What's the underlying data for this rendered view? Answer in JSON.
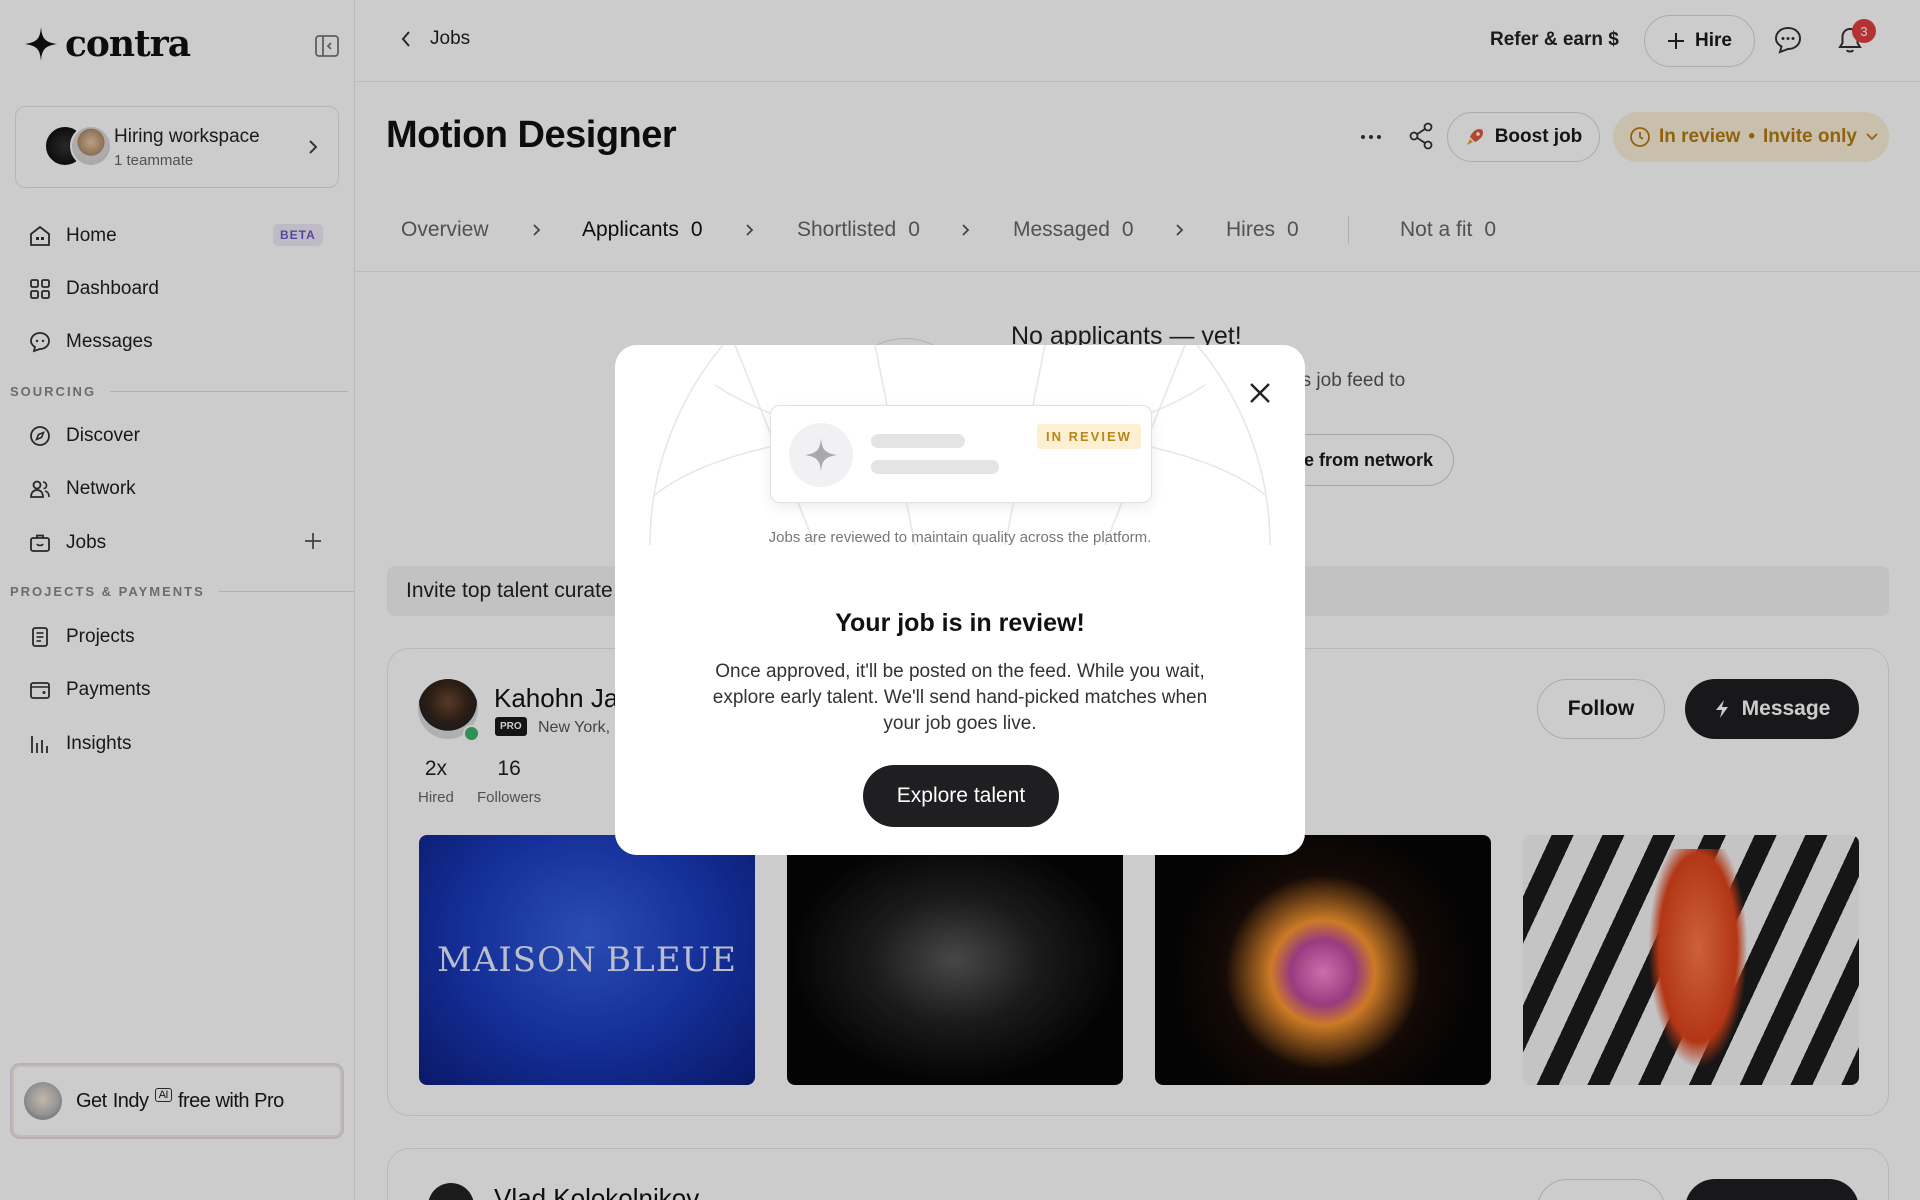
{
  "brand": {
    "name": "contra"
  },
  "workspace": {
    "title": "Hiring workspace",
    "subtitle": "1 teammate"
  },
  "nav": {
    "home": "Home",
    "home_badge": "BETA",
    "dashboard": "Dashboard",
    "messages": "Messages",
    "sourcing_label": "SOURCING",
    "discover": "Discover",
    "network": "Network",
    "jobs": "Jobs",
    "projects_label": "PROJECTS & PAYMENTS",
    "projects": "Projects",
    "payments": "Payments",
    "insights": "Insights"
  },
  "promo": {
    "get": "Get",
    "indy": "Indy",
    "ai": "AI",
    "rest": "free with Pro"
  },
  "topbar": {
    "back_label": "Jobs",
    "refer": "Refer & earn $",
    "hire": "Hire",
    "notification_count": "3"
  },
  "job": {
    "title": "Motion Designer",
    "boost": "Boost job",
    "status": "In review",
    "status_sep": "•",
    "visibility": "Invite only"
  },
  "tabs": [
    {
      "label": "Overview",
      "count": ""
    },
    {
      "label": "Applicants",
      "count": "0"
    },
    {
      "label": "Shortlisted",
      "count": "0"
    },
    {
      "label": "Messaged",
      "count": "0"
    },
    {
      "label": "Hires",
      "count": "0"
    },
    {
      "label": "Not a fit",
      "count": "0"
    }
  ],
  "empty": {
    "title": "No applicants — yet!",
    "text": "'s job feed to",
    "invite_button": "e from network"
  },
  "invite_banner": "Invite top talent curate",
  "talent": {
    "name": "Kahohn Jac",
    "pro": "PRO",
    "location": "New York,",
    "stats": [
      {
        "value": "2x",
        "label": "Hired"
      },
      {
        "value": "16",
        "label": "Followers"
      }
    ],
    "follow": "Follow",
    "message": "Message",
    "thumb1_left": "MAISON",
    "thumb1_right": "BLEUE"
  },
  "talent2": {
    "name": "Vlad Kolokolnikov"
  },
  "modal": {
    "preview_badge": "IN REVIEW",
    "caption": "Jobs are reviewed to maintain quality across the platform.",
    "title": "Your job is in review!",
    "body": "Once approved, it'll be posted on the feed. While you wait, explore early talent. We'll send hand-picked matches when your job goes live.",
    "cta": "Explore talent"
  },
  "colors": {
    "accent_dark": "#1f1f22",
    "status_amber": "#b77a10",
    "status_bg": "#fbf1d8",
    "online_green": "#3db36b",
    "notification_red": "#e04040"
  }
}
